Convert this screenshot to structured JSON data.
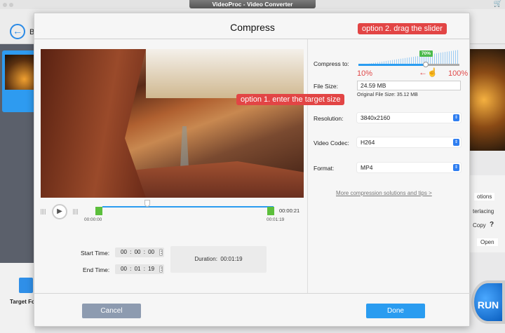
{
  "app": {
    "title": "VideoProc - Video Converter",
    "back_label": "B",
    "target_format_label": "Target Fo",
    "run_label": "RUN",
    "right_panel": {
      "options": "otions",
      "interlacing": "terlacing",
      "copy": "Copy",
      "help": "?",
      "open": "Open"
    }
  },
  "dialog": {
    "title": "Compress",
    "timeline": {
      "start_label": "00:00:00",
      "end_label": "00:01:19",
      "current_time": "00:00:21"
    },
    "start_time": {
      "label": "Start Time:",
      "value": "00 : 00 : 00"
    },
    "end_time": {
      "label": "End Time:",
      "value": "00 : 01 : 19"
    },
    "duration": {
      "label": "Duration:",
      "value": "00:01:19"
    },
    "compress": {
      "label": "Compress to:",
      "percent": 70,
      "percent_label": "70%",
      "min_label": "10%",
      "max_label": "100%"
    },
    "file_size": {
      "label": "File Size:",
      "value": "24.59 MB",
      "original": "Original File Size: 35.12 MB"
    },
    "resolution": {
      "label": "Resolution:",
      "value": "3840x2160"
    },
    "video_codec": {
      "label": "Video Codec:",
      "value": "H264"
    },
    "format": {
      "label": "Format:",
      "value": "MP4"
    },
    "link": "More compression solutions and tips >",
    "cancel": "Cancel",
    "done": "Done"
  },
  "annotations": {
    "option1": "option 1. enter the target size",
    "option2": "option 2. drag the slider"
  },
  "colors": {
    "accent": "#2a9cf0",
    "callout": "#e24545",
    "handle": "#5cbf3c"
  }
}
